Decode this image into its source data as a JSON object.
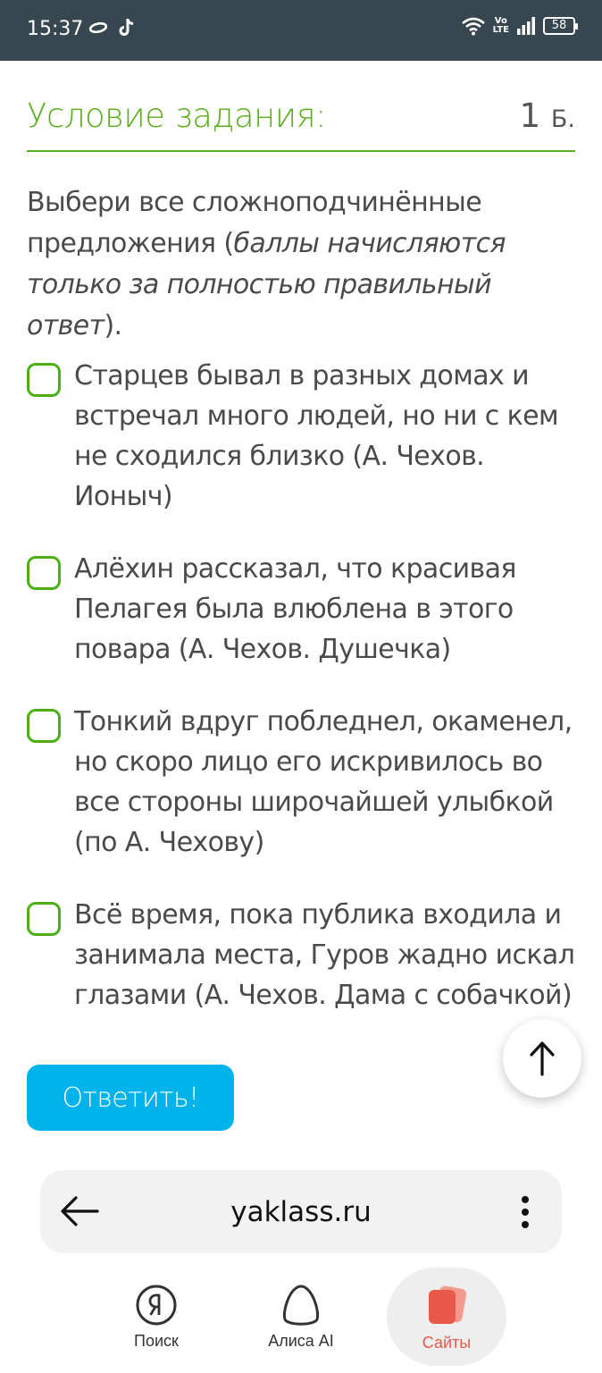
{
  "status_bar": {
    "time": "15:37",
    "left_icons": [
      "ring-icon",
      "tiktok-icon"
    ],
    "network": "Vo LTE",
    "battery": "58"
  },
  "task": {
    "title": "Условие задания:",
    "points": "1",
    "points_unit": "Б.",
    "question_plain": "Выбери все сложноподчинённые предложения (",
    "question_italic": "баллы начисляются только за полностью правильный ответ",
    "question_end": ").",
    "options": [
      {
        "text": "Старцев бывал в разных домах и встречал много людей, но ни с кем не сходился близко (А. Чехов. Ионыч)",
        "checked": false
      },
      {
        "text": "Алёхин рассказал, что красивая Пелагея была влюблена в этого повара (А. Чехов. Душечка)",
        "checked": false
      },
      {
        "text": "Тонкий вдруг побледнел, окаменел, но скоро лицо его искривилось во все стороны широчайшей улыбкой (по А. Чехову)",
        "checked": false
      },
      {
        "text": "Всё время, пока публика входила и занимала места, Гуров жадно искал глазами (А. Чехов. Дама с собачкой)",
        "checked": false
      }
    ],
    "answer_button": "Ответить!"
  },
  "browser": {
    "url": "yaklass.ru"
  },
  "bottom_nav": {
    "items": [
      {
        "label": "Поиск",
        "icon": "yandex-search-icon",
        "active": false
      },
      {
        "label": "Алиса AI",
        "icon": "alice-icon",
        "active": false
      },
      {
        "label": "Сайты",
        "icon": "sites-icon",
        "active": true
      }
    ]
  },
  "colors": {
    "status_bar_bg": "#37474f",
    "accent_green": "#5aad1f",
    "checkbox_green": "#4caf14",
    "button_blue": "#00b4eb",
    "active_red": "#e8594b"
  }
}
